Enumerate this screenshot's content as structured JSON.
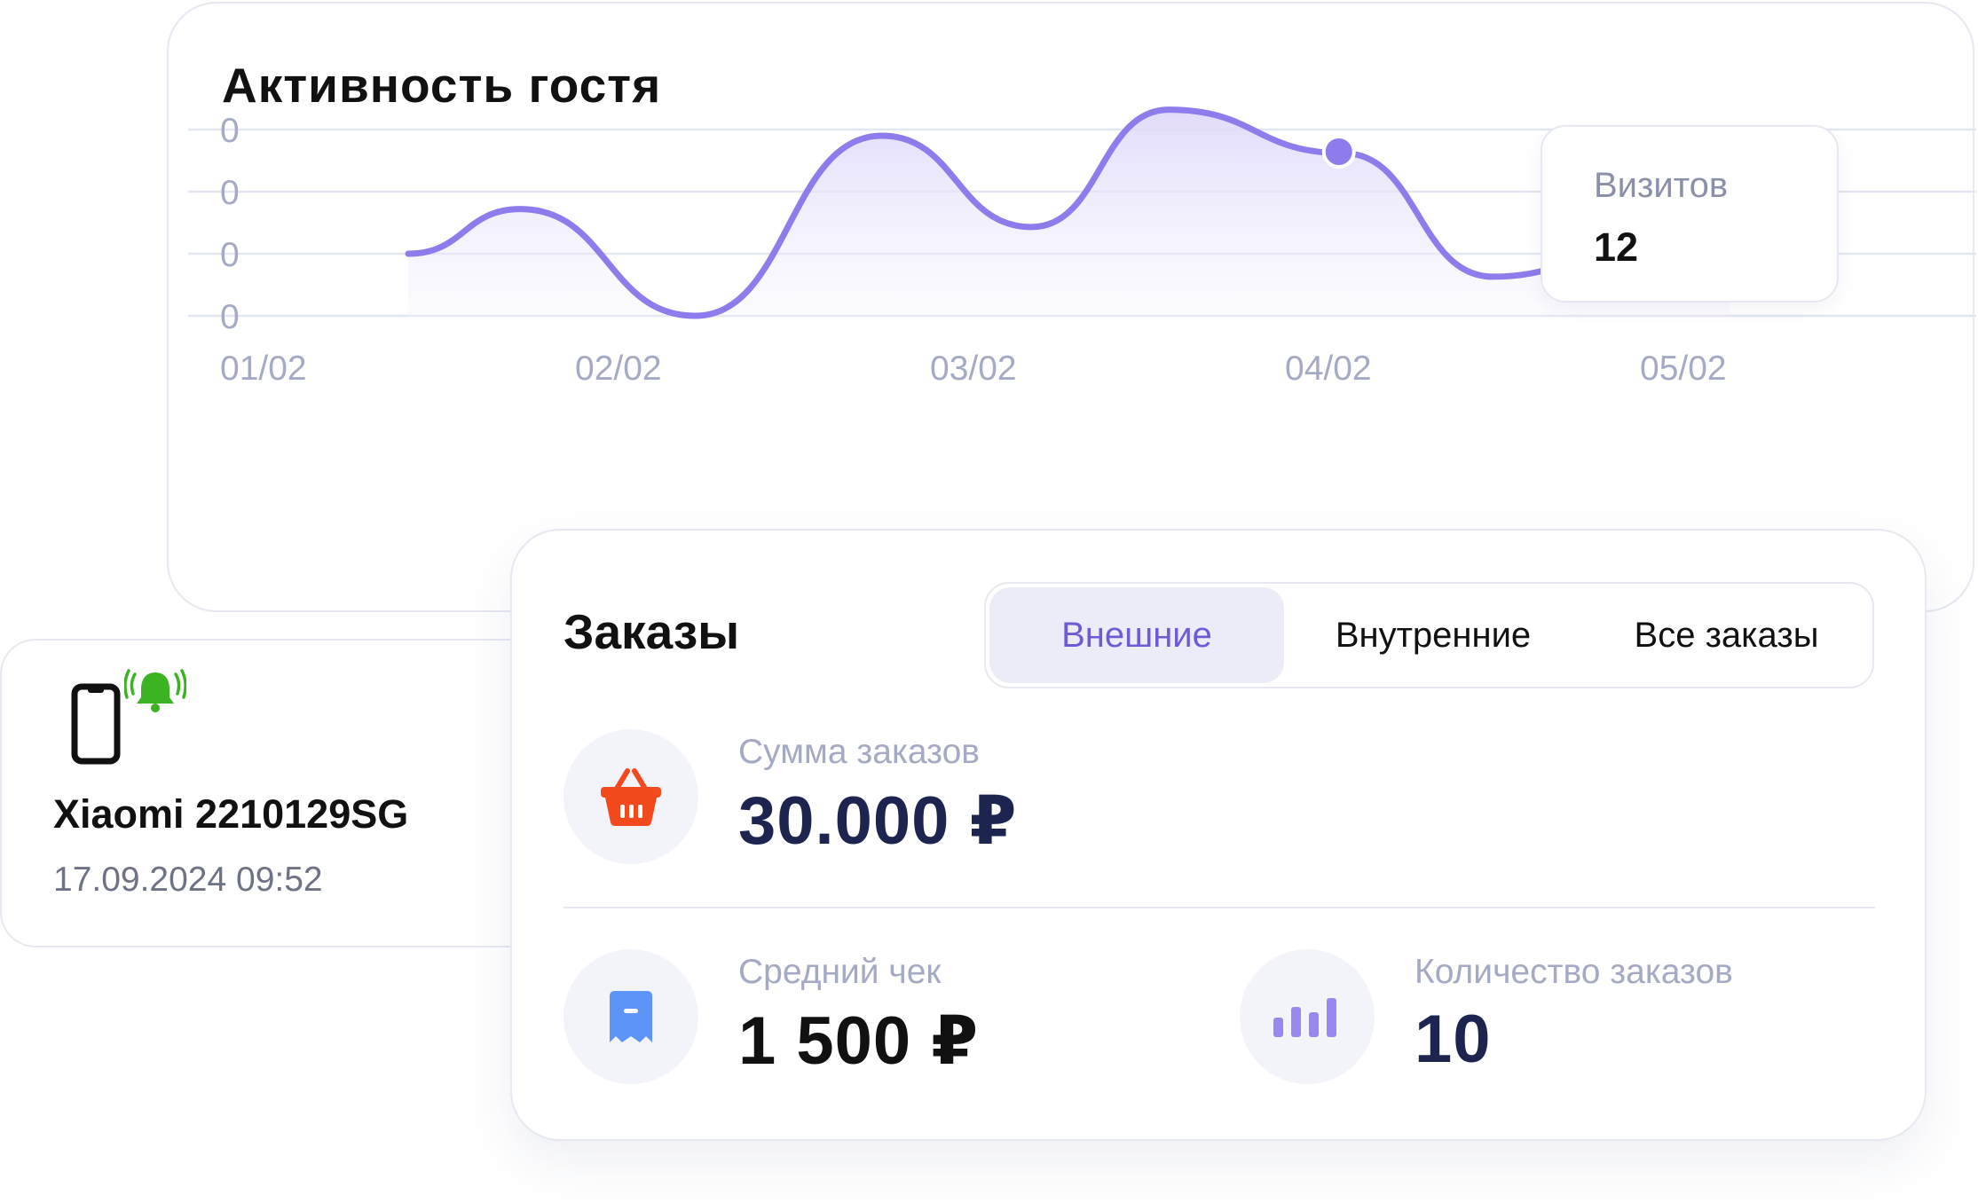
{
  "activity": {
    "title": "Активность гостя",
    "tooltip": {
      "label": "Визитов",
      "value": "12"
    },
    "chart_data": {
      "type": "area",
      "y_tick_labels": [
        "0",
        "0",
        "0",
        "0"
      ],
      "x_tick_labels": [
        "01/02",
        "02/02",
        "03/02",
        "04/02",
        "05/02"
      ],
      "series": [
        {
          "x": [
            0.0,
            0.45,
            1.15,
            1.9,
            2.5,
            3.05,
            3.75,
            4.35,
            5.3
          ],
          "values": [
            1.0,
            1.72,
            0.0,
            2.9,
            1.43,
            3.32,
            2.62,
            0.63,
            1.94
          ]
        }
      ],
      "highlight": {
        "x": 3.75,
        "value": 12
      },
      "color": "#8e7cec",
      "fill": "#ede9fb",
      "grid": true
    }
  },
  "device": {
    "name": "Xiaomi 2210129SG",
    "datetime": "17.09.2024 09:52",
    "icons": [
      "phone-icon",
      "bell-ringing-icon"
    ],
    "bell_color": "#3bb322"
  },
  "orders": {
    "title": "Заказы",
    "tabs": [
      {
        "label": "Внешние",
        "active": true
      },
      {
        "label": "Внутренние",
        "active": false
      },
      {
        "label": "Все заказы",
        "active": false
      }
    ],
    "sum": {
      "label": "Сумма заказов",
      "value": "30.000 ₽",
      "icon": "basket-icon",
      "icon_color": "#f24a1d"
    },
    "average": {
      "label": "Средний чек",
      "value": "1 500 ₽",
      "icon": "receipt-icon",
      "icon_color": "#5c95f7"
    },
    "count": {
      "label": "Количество заказов",
      "value": "10",
      "icon": "bar-chart-icon",
      "icon_color": "#9a88f1"
    }
  },
  "colors": {
    "accent": "#6a5cd3",
    "value_text": "#1d2450",
    "muted_text": "#a4aac3"
  }
}
